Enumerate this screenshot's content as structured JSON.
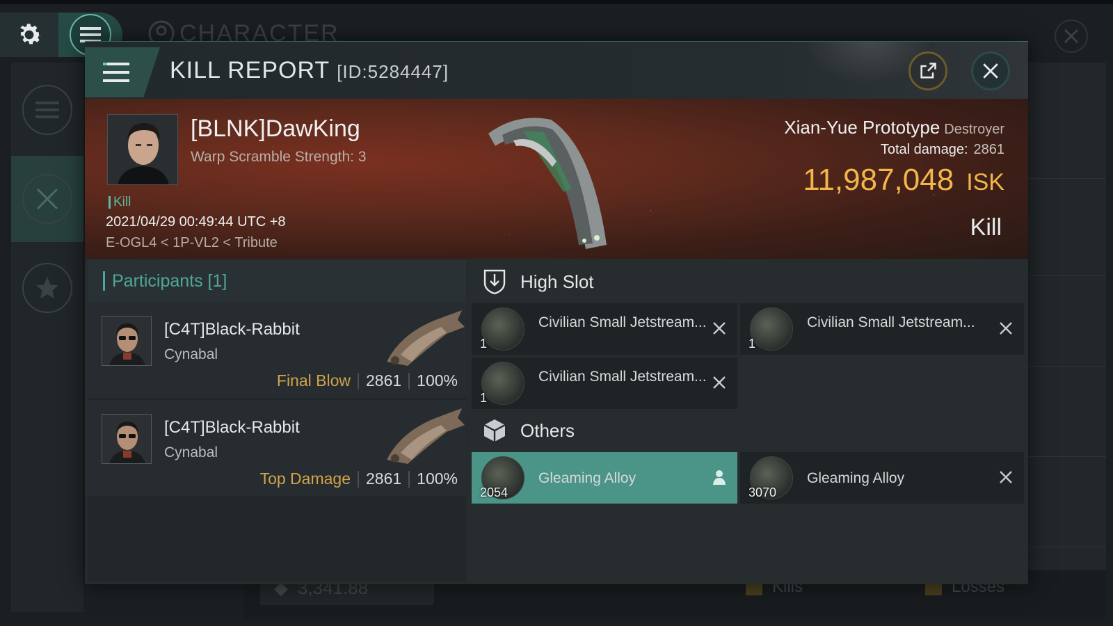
{
  "background": {
    "title": "CHARACTER",
    "bottom_value": "3,341.88",
    "bottom_tags": [
      "Kills",
      "Losses"
    ]
  },
  "header": {
    "title": "KILL REPORT",
    "id": "[ID:5284447]"
  },
  "victim": {
    "name": "[BLNK]DawKing",
    "subtitle": "Warp Scramble Strength: 3",
    "tag": "Kill",
    "timestamp": "2021/04/29 00:49:44 UTC +8",
    "location": "E-OGL4 < 1P-VL2 < Tribute"
  },
  "ship": {
    "name": "Xian-Yue Prototype",
    "class": "Destroyer",
    "total_damage_label": "Total damage:",
    "total_damage": "2861",
    "isk_value": "11,987,048",
    "isk_unit": "ISK",
    "result": "Kill"
  },
  "participants": {
    "header": "Participants [1]",
    "rows": [
      {
        "name": "[C4T]Black-Rabbit",
        "ship": "Cynabal",
        "role": "Final Blow",
        "damage": "2861",
        "percent": "100%"
      },
      {
        "name": "[C4T]Black-Rabbit",
        "ship": "Cynabal",
        "role": "Top Damage",
        "damage": "2861",
        "percent": "100%"
      }
    ]
  },
  "fitting": {
    "high_slot_label": "High Slot",
    "others_label": "Others",
    "high_slot": [
      {
        "name": "Civilian Small Jetstream...",
        "qty": "1"
      },
      {
        "name": "Civilian Small Jetstream...",
        "qty": "1"
      },
      {
        "name": "Civilian Small Jetstream...",
        "qty": "1"
      }
    ],
    "others": [
      {
        "name": "Gleaming Alloy",
        "qty": "2054",
        "status": "dropped"
      },
      {
        "name": "Gleaming Alloy",
        "qty": "3070",
        "status": "destroyed"
      }
    ]
  },
  "colors": {
    "accent": "#4ea79a",
    "isk": "#f3b64a",
    "role": "#d2a44a",
    "highlight": "#4a9488"
  }
}
